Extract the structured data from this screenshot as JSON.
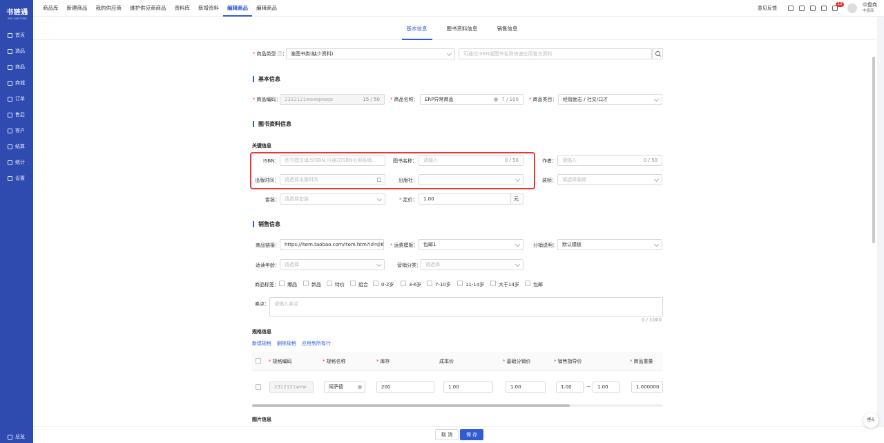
{
  "app": {
    "logo": "书链通",
    "logo_sub": "SHU LIAN TONG"
  },
  "sidebar": {
    "items": [
      {
        "label": "首页",
        "icon": "home-icon"
      },
      {
        "label": "选品",
        "icon": "select-icon"
      },
      {
        "label": "商品",
        "icon": "goods-icon"
      },
      {
        "label": "商城",
        "icon": "mall-icon"
      },
      {
        "label": "订单",
        "icon": "order-icon"
      },
      {
        "label": "售后",
        "icon": "aftersale-icon"
      },
      {
        "label": "客户",
        "icon": "customer-icon"
      },
      {
        "label": "结算",
        "icon": "settle-icon"
      },
      {
        "label": "统计",
        "icon": "stats-icon"
      },
      {
        "label": "设置",
        "icon": "settings-icon"
      }
    ],
    "bottom": "总览"
  },
  "topbar": {
    "tabs": [
      "商品库",
      "新建商品",
      "我的供应商",
      "维护供应商商品",
      "资料库",
      "新增资料",
      "编辑商品",
      "编辑商品"
    ],
    "active_index": 6,
    "feedback": "意见反馈",
    "badge": "12",
    "user": "中盘商",
    "user_sub": "中盘商"
  },
  "section_tabs": {
    "items": [
      "基本信息",
      "图书资料信息",
      "销售信息"
    ],
    "active_index": 0
  },
  "form": {
    "product_type": {
      "label": "商品类型",
      "value": "准图书类(缺少资料)",
      "search_placeholder": "可通过ISBN或图书名称快速应用官方资料"
    },
    "basic": {
      "title": "基本信息",
      "code": {
        "label": "商品编码：",
        "value": "2312121wewqewqe",
        "count": "15 / 50"
      },
      "name": {
        "label": "商品名称：",
        "value": "ERP异常商品",
        "count": "7 / 100"
      },
      "category": {
        "label": "商品类目：",
        "value": "经管励志 / 社交/口才"
      }
    },
    "book": {
      "title": "图书资料信息",
      "sub": "关键信息",
      "isbn": {
        "label": "ISBN：",
        "placeholder": "图书建议填写ISBN,可通过ISBN引用系统..."
      },
      "book_name": {
        "label": "图书名称：",
        "placeholder": "请输入",
        "count": "0 / 50"
      },
      "author": {
        "label": "作者：",
        "placeholder": "请输入",
        "count": "0 / 50"
      },
      "pub_date": {
        "label": "出版时间：",
        "placeholder": "请选择出版时间"
      },
      "publisher": {
        "label": "出版社：",
        "value": ""
      },
      "binding": {
        "label": "装帧：",
        "placeholder": "请选择装帧"
      },
      "set": {
        "label": "套装：",
        "placeholder": "请选择套装"
      },
      "price": {
        "label": "定价：",
        "value": "1.00",
        "unit": "元"
      }
    },
    "sales": {
      "title": "销售信息",
      "link": {
        "label": "商品链接：",
        "value": "https://item.taobao.com/item.htm?id=76("
      },
      "freight": {
        "label": "运费模板：",
        "value": "包邮1"
      },
      "dist": {
        "label": "分销说明：",
        "value": "默认模板"
      },
      "age": {
        "label": "适读年龄：",
        "placeholder": "请选择"
      },
      "marketing": {
        "label": "营销分类：",
        "placeholder": "请选择"
      },
      "tags": {
        "label": "商品标签：",
        "items": [
          "爆品",
          "新品",
          "特价",
          "组合",
          "0-2岁",
          "3-6岁",
          "7-10岁",
          "11-14岁",
          "大于14岁",
          "包邮"
        ]
      },
      "selling": {
        "label": "卖点：",
        "placeholder": "请输入卖点",
        "count": "0 / 1000"
      }
    },
    "spec": {
      "title": "规格信息",
      "actions": [
        "新建规格",
        "删除规格",
        "应用到所有行"
      ],
      "headers": [
        "规格编码",
        "规格名称",
        "库存",
        "成本价",
        "基础分销价",
        "销售指导价",
        "商品重量"
      ],
      "required": [
        true,
        true,
        true,
        false,
        true,
        true,
        true
      ],
      "row": {
        "code": "2312121wew",
        "name": "阿萨德",
        "stock": "200",
        "cost": "1.00",
        "base": "1.00",
        "guide_min": "1.00",
        "guide_max": "1.00",
        "weight": "1.000000"
      }
    },
    "images": {
      "title": "图片信息"
    }
  },
  "footer": {
    "cancel": "取 消",
    "save": "保 存"
  },
  "float": "埋点"
}
